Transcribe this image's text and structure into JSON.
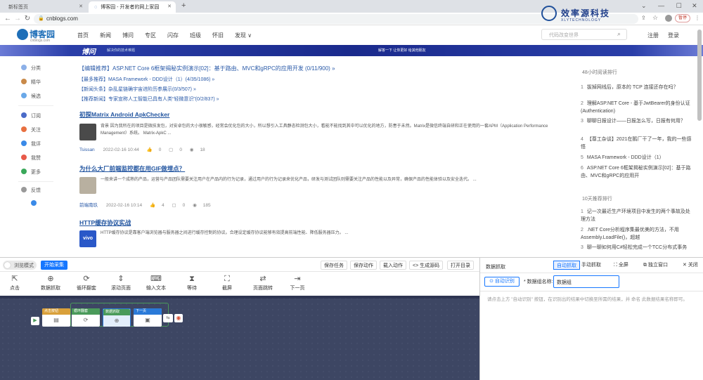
{
  "browser": {
    "tabs": [
      {
        "label": "新标签页"
      },
      {
        "label": "博客园 - 开发者的网上家园"
      }
    ],
    "new_tab": "+",
    "url": "cnblogs.com",
    "profile_badge": "暂停"
  },
  "watermark": {
    "title": "效率源科技",
    "subtitle": "XLYTECHNOLOGY"
  },
  "site": {
    "logo": "博客园",
    "logo_sub": "cnblogs.com",
    "nav": [
      "首页",
      "新闻",
      "博问",
      "专区",
      "闪存",
      "班级",
      "怀旧",
      "发现 ∨"
    ],
    "search_placeholder": "代码改变世界",
    "register": "注册",
    "login": "登录"
  },
  "banner": {
    "title": "博问",
    "subtitle": "解决你的技术难题",
    "right": "解答一下 让你更好 给其他朋友"
  },
  "sidebar": [
    {
      "label": "分类",
      "color": "#8cb0e8"
    },
    {
      "label": "精华",
      "color": "#c98a4a"
    },
    {
      "label": "候选",
      "color": "#6aa8e8"
    },
    {
      "label": "订阅",
      "color": "#4a6ac8"
    },
    {
      "label": "关注",
      "color": "#e87040"
    },
    {
      "label": "我评",
      "color": "#3a8ae8"
    },
    {
      "label": "我赞",
      "color": "#e85a4a"
    },
    {
      "label": "更多",
      "color": "#3aa85a"
    },
    {
      "label": "反馈",
      "color": "#999999"
    },
    {
      "label": "",
      "color": "#3a8ae8"
    }
  ],
  "recommended": [
    "【编辑推荐】ASP.NET Core 6框架揭秘实例演示[02]：基于路由、MVC和gRPC的应用开发 (0/11/900) »",
    "【最多推荐】MASA Framework - DDD设计（1）(4/35/1086) »",
    "【新闻头条】杂乱星链确宇宙进阶历参展示(0/3/507) »",
    "【推荐新闻】专家宣称人工智能已具有人类“轻微意识”(0/2/837) »"
  ],
  "posts": [
    {
      "title": "初探Matrix Android ApkChecker",
      "summary": "背景 因为我所在的项目是微技发包，对安卓包的大小很敏感，经常会优化包的大小，所以想引入工具静态检测包大小，看能不能找到其中可以优化的地方，防患于未然。Matrix是微信终端自研和正在使用的一套APM（Application Performance Management）系统。 Matrix-ApkC ...",
      "author": "Tsissan",
      "date": "2022-02-16 10:44",
      "likes": "0",
      "comments": "0",
      "views": "18",
      "thumb_color": "#4a4a4a"
    },
    {
      "title": "为什么大厂前端监控都在用GIF做埋点？",
      "summary": "一般来讲一个成熟的产品，运营与产品团队需要关注用户在产品内的行为记录，通过用户的行为记录来优化产品，研发与测试团队则需要关注产品的性能以及异常，确保产品的性能体验以及安全迭代。 ...",
      "author": "前端南玖",
      "date": "2022-02-16 10:14",
      "likes": "4",
      "comments": "0",
      "views": "185",
      "thumb_color": "#b8b0a0"
    },
    {
      "title": "HTTP缓存协议实战",
      "summary": "HTTP缓存协议是靠客户端浏览器与服务器之间进行缓存控制的协议。合理设定缓存协议能够有效提高前端性能、降低服务器压力。 ...",
      "author": "",
      "date": "",
      "likes": "",
      "comments": "",
      "views": "",
      "thumb_color": "#2a58c8",
      "thumb_text": "vivo"
    }
  ],
  "right_rank_48h": {
    "heading": "48小时阅读排行",
    "items": [
      {
        "n": "1",
        "text": "拔掉网线后，原本的 TCP 连接还存在吗？"
      },
      {
        "n": "2",
        "text": "理解ASP.NET Core - 基于JwtBearer的身份认证(Authentication)"
      },
      {
        "n": "3",
        "text": "聊聊日报设计——日报怎么写，日报有何用？"
      },
      {
        "n": "4",
        "text": "【尊工杂谈】2021在鹅厂干了一年，我的一些感悟"
      },
      {
        "n": "5",
        "text": "MASA Framework - DDD设计（1）"
      },
      {
        "n": "6",
        "text": "ASP.NET Core 6框架揭秘实例演示[02]：基于路由、MVC和gRPC的应用开"
      }
    ]
  },
  "right_rank_10d": {
    "heading": "10天推荐排行",
    "items": [
      {
        "n": "1",
        "text": "记一次最近生产环境项目中发生的两个事故及处理方法"
      },
      {
        "n": "2",
        "text": ".NET Core分析程序集最优美的方法，不用Assembly.LoadFile()，超越"
      },
      {
        "n": "3",
        "text": "聊一聊如何用C#轻松完成一个TCC分布式事务"
      }
    ]
  },
  "tool": {
    "mode_toggle": "浏览模式",
    "start": "开始采集",
    "actions": [
      "保存任务",
      "保存动作",
      "载入动作",
      "<> 生成源码",
      "打开目录"
    ],
    "tools": [
      {
        "label": "点击",
        "icon": "⇱"
      },
      {
        "label": "数据抓取",
        "icon": "⊕"
      },
      {
        "label": "循环翻套",
        "icon": "⟳"
      },
      {
        "label": "滚动页面",
        "icon": "⇕"
      },
      {
        "label": "输入文本",
        "icon": "⌨"
      },
      {
        "label": "等待",
        "icon": "⧗"
      },
      {
        "label": "截屏",
        "icon": "⛶"
      },
      {
        "label": "页面跳转",
        "icon": "⇄"
      },
      {
        "label": "下一页",
        "icon": "⇥"
      }
    ],
    "nodes": [
      {
        "title": "点击按钮",
        "color": "#d9a03a"
      },
      {
        "title": "循环翻套",
        "color": "#4a9a5a"
      },
      {
        "title": "数据抓取",
        "color": "#4a9a5a"
      },
      {
        "title": "下一页",
        "color": "#2a7ad8"
      }
    ]
  },
  "datapanel": {
    "title": "数据抓取",
    "tabs": [
      "自动抓取",
      "手动抓取",
      "全屏",
      "独立窗口",
      "关闭"
    ],
    "auto_btn": "自动识别",
    "ds_label": "* 数据组名称:",
    "ds_value": "数据组",
    "hint": "请点击上方 \"自动识别\" 按钮，在识别出的结果中切换至所需的结果，并 命名 此数据结果名称即可。"
  }
}
